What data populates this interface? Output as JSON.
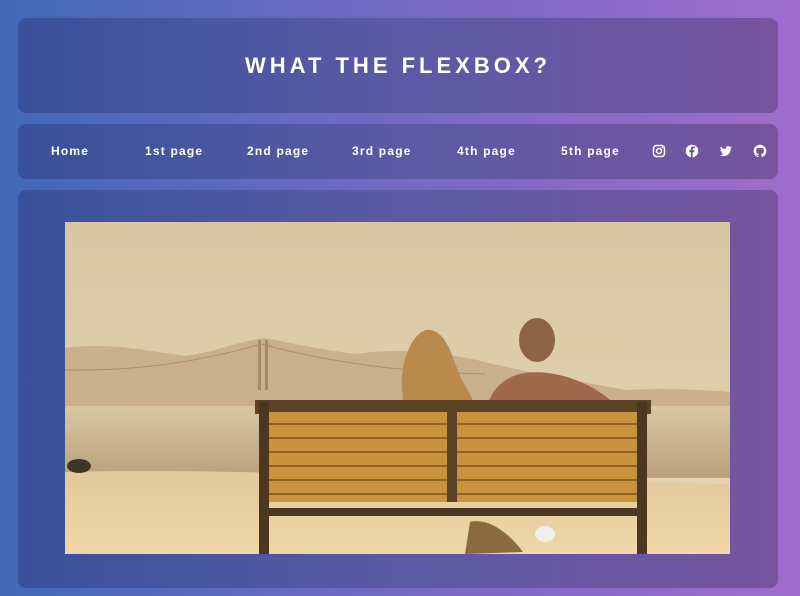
{
  "header": {
    "title": "WHAT THE FLEXBOX?"
  },
  "nav": {
    "links": [
      "Home",
      "1st page",
      "2nd page",
      "3rd page",
      "4th page",
      "5th page"
    ],
    "social": [
      "instagram-icon",
      "facebook-icon",
      "twitter-icon",
      "github-icon"
    ]
  },
  "main": {
    "image": "photo of a couple sitting on a bench by the bay"
  },
  "colors": {
    "background_start": "#4169b8",
    "background_end": "#a06ccd",
    "panel_start": "#38519a",
    "panel_end": "#77549e",
    "text": "#ffffff"
  }
}
